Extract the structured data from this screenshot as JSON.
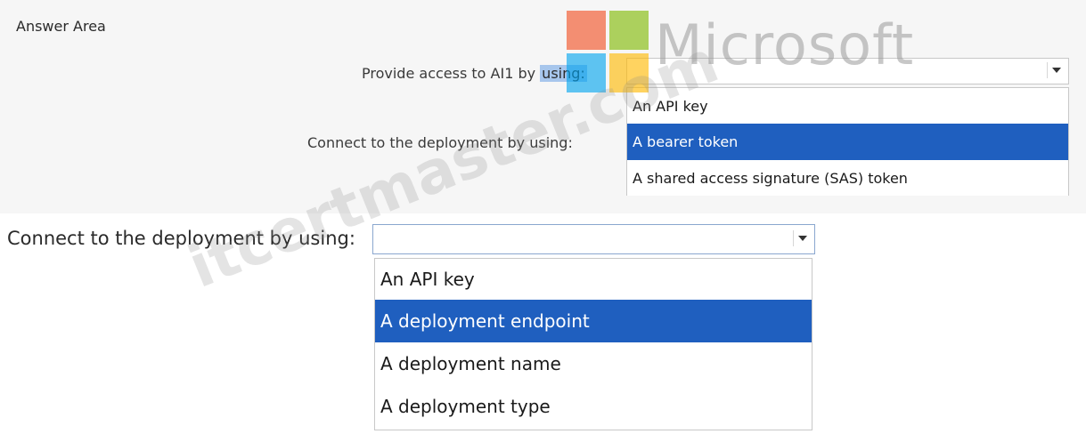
{
  "answer_area_label": "Answer Area",
  "q1": {
    "label_prefix": "Provide access to AI1 by ",
    "label_highlight": "using:"
  },
  "q2": {
    "label": "Connect to the deployment by using:",
    "options": [
      "An API key",
      "A bearer token",
      "A shared access signature (SAS) token"
    ],
    "selected_index": 1
  },
  "q3": {
    "label": "Connect to the deployment by using:",
    "options": [
      "An API key",
      "A deployment endpoint",
      "A deployment name",
      "A deployment type"
    ],
    "selected_index": 1
  },
  "watermark": {
    "logo_text": "Microsoft",
    "site_text": "itcertmaster.com",
    "logo_colors": [
      "#f25022",
      "#7fba00",
      "#00a4ef",
      "#ffb900"
    ]
  },
  "colors": {
    "selected_bg": "#1f5fbf",
    "selected_text": "#ffffff"
  },
  "icons": {
    "dropdown_arrow": "triangle-down-icon"
  }
}
